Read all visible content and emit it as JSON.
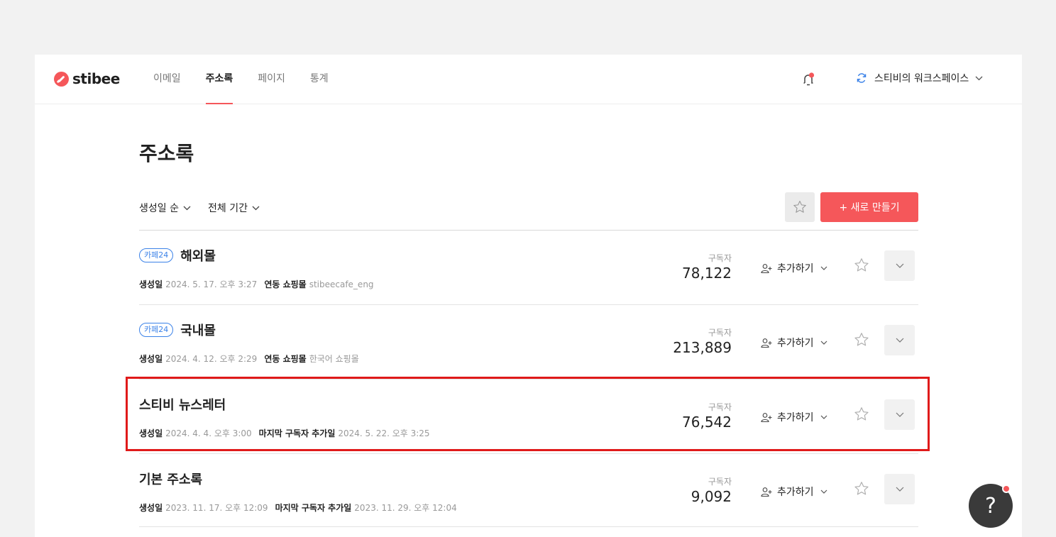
{
  "brand": {
    "name": "stibee",
    "accent": "#f5575a",
    "link": "#3b82e8"
  },
  "nav": {
    "items": [
      {
        "label": "이메일",
        "active": false
      },
      {
        "label": "주소록",
        "active": true
      },
      {
        "label": "페이지",
        "active": false
      },
      {
        "label": "통계",
        "active": false
      }
    ]
  },
  "header": {
    "workspace": "스티비의 워크스페이스",
    "notification_icon": "bell-icon",
    "has_unread": true
  },
  "page": {
    "title": "주소록",
    "sort_label": "생성일 순",
    "period_label": "전체 기간",
    "new_button": "+ 새로 만들기"
  },
  "lists": [
    {
      "tag": "카페24",
      "name": "해외몰",
      "created_label": "생성일",
      "created": "2024. 5. 17. 오후 3:27",
      "extra_label": "연동 쇼핑몰",
      "extra_value": "stibeecafe_eng",
      "subscriber_label": "구독자",
      "subscribers": "78,122",
      "add_label": "추가하기"
    },
    {
      "tag": "카페24",
      "name": "국내몰",
      "created_label": "생성일",
      "created": "2024. 4. 12. 오후 2:29",
      "extra_label": "연동 쇼핑몰",
      "extra_value": "한국어 쇼핑몰",
      "subscriber_label": "구독자",
      "subscribers": "213,889",
      "add_label": "추가하기"
    },
    {
      "tag": "",
      "name": "스티비 뉴스레터",
      "created_label": "생성일",
      "created": "2024. 4. 4. 오후 3:00",
      "extra_label": "마지막 구독자 추가일",
      "extra_value": "2024. 5. 22. 오후 3:25",
      "subscriber_label": "구독자",
      "subscribers": "76,542",
      "add_label": "추가하기"
    },
    {
      "tag": "",
      "name": "기본 주소록",
      "created_label": "생성일",
      "created": "2023. 11. 17. 오후 12:09",
      "extra_label": "마지막 구독자 추가일",
      "extra_value": "2023. 11. 29. 오후 12:04",
      "subscriber_label": "구독자",
      "subscribers": "9,092",
      "add_label": "추가하기"
    }
  ],
  "help": {
    "label": "?"
  }
}
